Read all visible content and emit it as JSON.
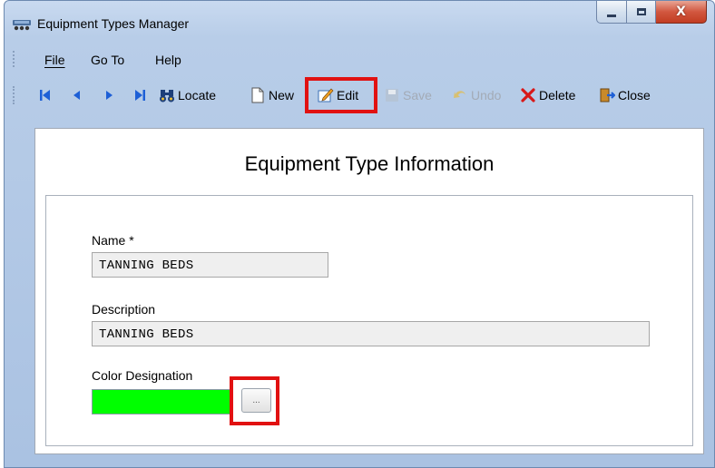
{
  "window": {
    "title": "Equipment Types Manager"
  },
  "window_controls": {
    "close_glyph": "X"
  },
  "menu": [
    "File",
    "Go To",
    "Help"
  ],
  "toolbar": {
    "locate": "Locate",
    "new": "New",
    "edit": "Edit",
    "save": "Save",
    "undo": "Undo",
    "delete": "Delete",
    "close": "Close"
  },
  "form": {
    "heading": "Equipment Type Information",
    "name_label": "Name *",
    "name_value": "TANNING BEDS",
    "description_label": "Description",
    "description_value": "TANNING BEDS",
    "color_label": "Color Designation",
    "color_value": "#00ff00",
    "color_button": "..."
  },
  "colors": {
    "highlight": "#e11111",
    "accent": "#1d5fd6"
  }
}
